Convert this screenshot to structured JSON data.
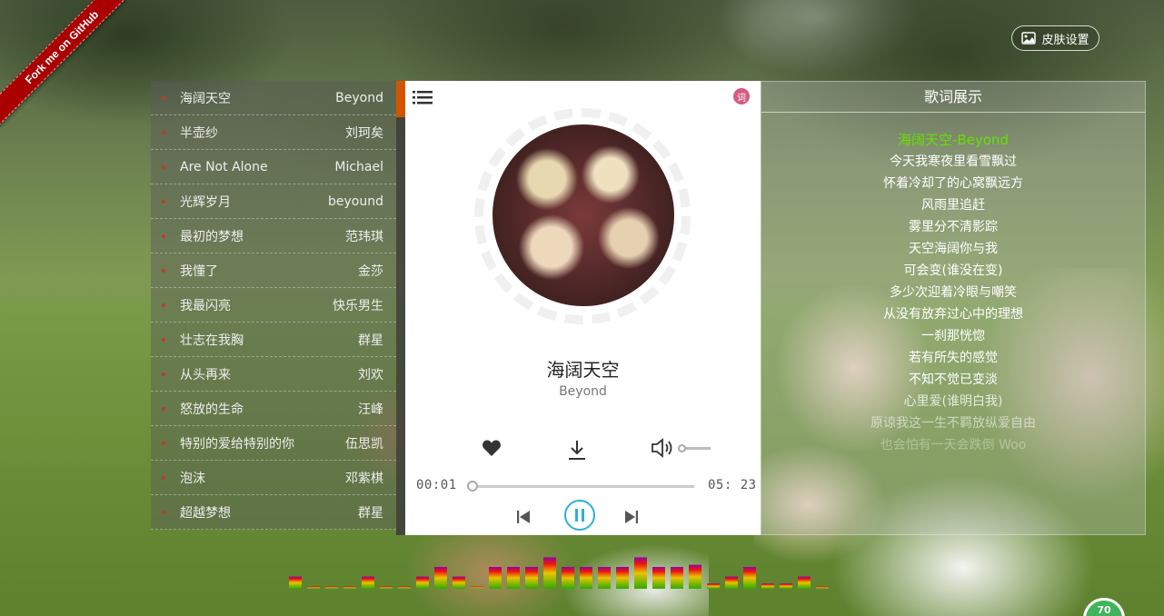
{
  "ribbon": {
    "label": "Fork me on GitHub"
  },
  "skin": {
    "label": "皮肤设置",
    "icon": "image-icon"
  },
  "playlist": {
    "items": [
      {
        "title": "海阔天空",
        "artist": "Beyond"
      },
      {
        "title": "半壶纱",
        "artist": "刘珂矣"
      },
      {
        "title": "Are Not Alone",
        "artist": "Michael"
      },
      {
        "title": "光辉岁月",
        "artist": "beyound"
      },
      {
        "title": "最初的梦想",
        "artist": "范玮琪"
      },
      {
        "title": "我懂了",
        "artist": "金莎"
      },
      {
        "title": "我最闪亮",
        "artist": "快乐男生"
      },
      {
        "title": "壮志在我胸",
        "artist": "群星"
      },
      {
        "title": "从头再来",
        "artist": "刘欢"
      },
      {
        "title": "怒放的生命",
        "artist": "汪峰"
      },
      {
        "title": "特别的爱给特别的你",
        "artist": "伍思凯"
      },
      {
        "title": "泡沫",
        "artist": "邓紫棋"
      },
      {
        "title": "超越梦想",
        "artist": "群星"
      }
    ]
  },
  "player": {
    "lyric_toggle": "词",
    "song_title": "海阔天空",
    "song_artist": "Beyond",
    "time_current": "00:01",
    "time_total": "05: 23",
    "progress": 0.003,
    "volume": 0.0,
    "accent_color": "#2ab0d8"
  },
  "lyrics": {
    "title": "歌词展示",
    "lines": [
      "海阔天空-Beyond",
      "今天我寒夜里看雪飘过",
      "怀着冷却了的心窝飘远方",
      "风雨里追赶",
      "雾里分不清影踪",
      "天空海阔你与我",
      "可会变(谁没在变)",
      "多少次迎着冷眼与嘲笑",
      "从没有放弃过心中的理想",
      "一刹那恍惚",
      "若有所失的感觉",
      "不知不觉已变淡",
      "心里爱(谁明白我)",
      "原谅我这一生不羁放纵爱自由",
      "也会怕有一天会跌倒 Woo"
    ],
    "active_color": "#66e000"
  },
  "visualizer": {
    "levels": [
      0.28,
      0.05,
      0.05,
      0.05,
      0.28,
      0.05,
      0.05,
      0.28,
      0.5,
      0.28,
      0.05,
      0.5,
      0.5,
      0.5,
      0.72,
      0.5,
      0.5,
      0.5,
      0.5,
      0.72,
      0.5,
      0.5,
      0.55,
      0.12,
      0.28,
      0.5,
      0.12,
      0.12,
      0.28,
      0.05,
      0.05,
      0.05
    ]
  },
  "badge": {
    "value": "70"
  }
}
